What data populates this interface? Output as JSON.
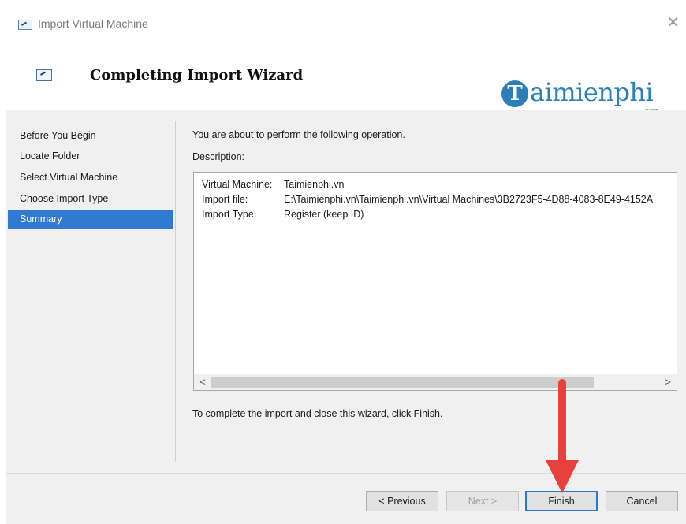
{
  "window": {
    "title": "Import Virtual Machine",
    "icon": "vm-window-icon",
    "close_glyph": "✕"
  },
  "header": {
    "title": "Completing Import Wizard"
  },
  "watermark": {
    "badge": "T",
    "name": "aimienphi",
    "tld": ".vn"
  },
  "nav": {
    "items": [
      {
        "label": "Before You Begin",
        "active": false
      },
      {
        "label": "Locate Folder",
        "active": false
      },
      {
        "label": "Select Virtual Machine",
        "active": false
      },
      {
        "label": "Choose Import Type",
        "active": false
      },
      {
        "label": "Summary",
        "active": true
      }
    ]
  },
  "main": {
    "intro": "You are about to perform the following operation.",
    "description_label": "Description:",
    "description": [
      {
        "key": "Virtual Machine:",
        "value": "Taimienphi.vn"
      },
      {
        "key": "Import file:",
        "value": "E:\\Taimienphi.vn\\Taimienphi.vn\\Virtual Machines\\3B2723F5-4D88-4083-8E49-4152A"
      },
      {
        "key": "Import Type:",
        "value": "Register (keep ID)"
      }
    ],
    "scroll_left": "<",
    "scroll_right": ">",
    "outro": "To complete the import and close this wizard, click Finish."
  },
  "buttons": {
    "previous": "< Previous",
    "next": "Next >",
    "finish": "Finish",
    "cancel": "Cancel"
  },
  "colors": {
    "selection": "#2f7bd1",
    "annotation_arrow": "#e8403c",
    "brand": "#2a7fb8"
  }
}
